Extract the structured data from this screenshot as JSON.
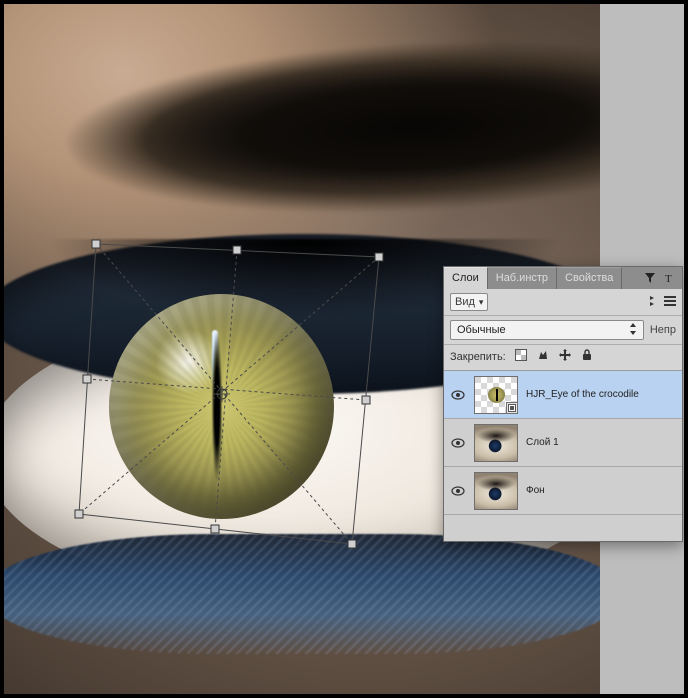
{
  "panel": {
    "tabs": {
      "layers": "Слои",
      "presets": "Наб.инстр",
      "properties": "Свойства"
    },
    "opts": {
      "vid_label": "Вид"
    },
    "blend": {
      "mode": "Обычные",
      "opacity_label": "Непр"
    },
    "lock": {
      "label": "Закрепить:"
    }
  },
  "layers": [
    {
      "name": "HJR_Eye of the crocodile",
      "selected": true,
      "smart": true,
      "thumb": "croc"
    },
    {
      "name": "Слой 1",
      "selected": false,
      "smart": false,
      "thumb": "eye"
    },
    {
      "name": "Фон",
      "selected": false,
      "smart": false,
      "thumb": "eye"
    }
  ],
  "icons": {
    "eye": "eye-icon",
    "filter": "filter-icon",
    "type": "type-icon",
    "chev": "chevron-down-icon",
    "chevs": "chevrons-icon",
    "checker": "checker-icon",
    "brush": "brush-icon",
    "move": "move-icon",
    "lock": "lock-icon",
    "menu": "menu-icon",
    "smart": "smart-object-icon"
  }
}
